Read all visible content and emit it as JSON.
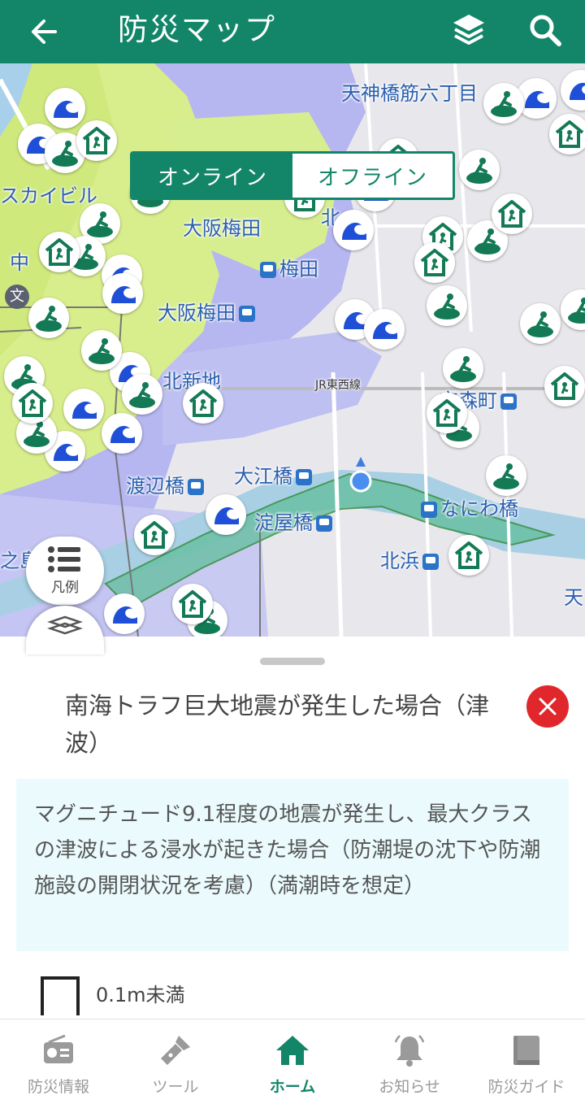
{
  "header": {
    "title": "防災マップ",
    "back_icon": "arrow-left-icon",
    "layers_icon": "layers-icon",
    "search_icon": "search-icon",
    "color": "#13866a"
  },
  "mode_toggle": {
    "online": "オンライン",
    "offline": "オフライン",
    "selected": "オンライン"
  },
  "map": {
    "labels": [
      "天神橋筋六丁目",
      "スカイビル",
      "大阪梅田",
      "梅田",
      "大阪梅田",
      "北新地",
      "JR東西線",
      "京森町",
      "渡辺橋",
      "大江橋",
      "なにわ橋",
      "淀屋橋",
      "北浜",
      "之島",
      "中",
      "北",
      "文",
      "天"
    ],
    "legend_button": "凡例"
  },
  "sheet": {
    "title": "南海トラフ巨大地震が発生した場合（津波）",
    "description": "マグニチュード9.1程度の地震が発生し、最大クラスの津波による浸水が起きた場合（防潮堤の沈下や防潮施設の開閉状況を考慮）（満潮時を想定）",
    "legend_item": "0.1m未満"
  },
  "nav": [
    {
      "label": "防災情報",
      "icon": "radio-icon"
    },
    {
      "label": "ツール",
      "icon": "flashlight-icon"
    },
    {
      "label": "ホーム",
      "icon": "home-icon",
      "active": true
    },
    {
      "label": "お知らせ",
      "icon": "bell-icon"
    },
    {
      "label": "防災ガイド",
      "icon": "book-icon"
    }
  ]
}
